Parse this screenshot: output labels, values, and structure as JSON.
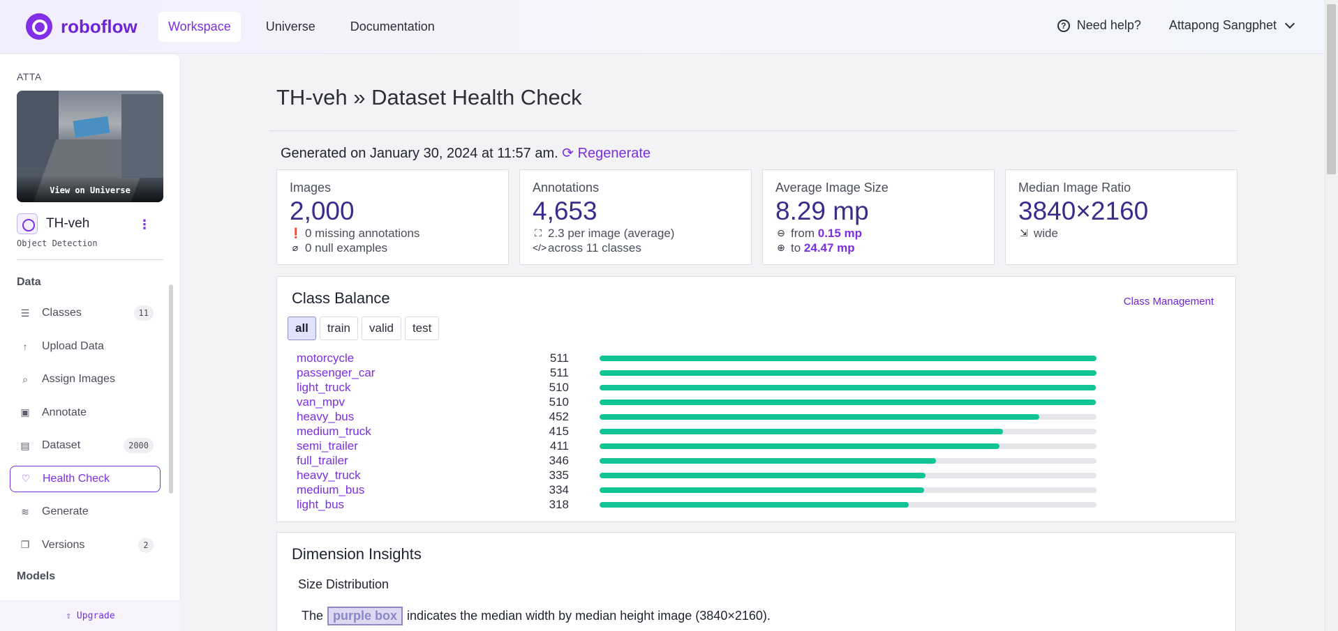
{
  "app": {
    "logo_text": "roboflow"
  },
  "nav": {
    "tabs": [
      "Workspace",
      "Universe",
      "Documentation"
    ],
    "active": "Workspace"
  },
  "top_right": {
    "help": "Need help?",
    "user": "Attapong Sangphet"
  },
  "sidebar": {
    "workspace": "ATTA",
    "view_on_universe": "View on Universe",
    "project_name": "TH-veh",
    "project_type": "Object Detection",
    "section_data": "Data",
    "items": [
      {
        "label": "Classes",
        "icon": "list-icon",
        "badge": "11"
      },
      {
        "label": "Upload Data",
        "icon": "arrow-up-icon",
        "badge": ""
      },
      {
        "label": "Assign Images",
        "icon": "search-icon",
        "badge": ""
      },
      {
        "label": "Annotate",
        "icon": "annotate-icon",
        "badge": ""
      },
      {
        "label": "Dataset",
        "icon": "image-icon",
        "badge": "2000"
      },
      {
        "label": "Health Check",
        "icon": "heart-icon",
        "badge": ""
      },
      {
        "label": "Generate",
        "icon": "layers-icon",
        "badge": ""
      },
      {
        "label": "Versions",
        "icon": "versions-icon",
        "badge": "2"
      }
    ],
    "section_models": "Models",
    "upgrade": "Upgrade"
  },
  "page": {
    "title_project": "TH-veh",
    "title_page": "Dataset Health Check",
    "generated": "Generated on January 30, 2024 at 11:57 am.",
    "regenerate": "Regenerate"
  },
  "cards": {
    "images": {
      "label": "Images",
      "value": "2,000",
      "line1": "0 missing annotations",
      "line2": "0 null examples"
    },
    "annotations": {
      "label": "Annotations",
      "value": "4,653",
      "line1": "2.3 per image (average)",
      "line2": "across 11 classes"
    },
    "avg_size": {
      "label": "Average Image Size",
      "value": "8.29 mp",
      "line1_pre": "from",
      "line1_val": "0.15 mp",
      "line2_pre": "to",
      "line2_val": "24.47 mp"
    },
    "ratio": {
      "label": "Median Image Ratio",
      "value": "3840×2160",
      "line1": "wide"
    }
  },
  "class_balance": {
    "title": "Class Balance",
    "link": "Class Management",
    "splits": [
      "all",
      "train",
      "valid",
      "test"
    ],
    "active_split": "all"
  },
  "chart_data": {
    "type": "bar",
    "categories": [
      "motorcycle",
      "passenger_car",
      "light_truck",
      "van_mpv",
      "heavy_bus",
      "medium_truck",
      "semi_trailer",
      "full_trailer",
      "heavy_truck",
      "medium_bus",
      "light_bus"
    ],
    "values": [
      511,
      511,
      510,
      510,
      452,
      415,
      411,
      346,
      335,
      334,
      318
    ],
    "max": 511,
    "orientation": "horizontal",
    "bar_color": "#10c496"
  },
  "dimension": {
    "title": "Dimension Insights",
    "subtitle": "Size Distribution",
    "note_pre": "The",
    "note_box": "purple box",
    "note_post": "indicates the median width by median height image (3840×2160)."
  }
}
